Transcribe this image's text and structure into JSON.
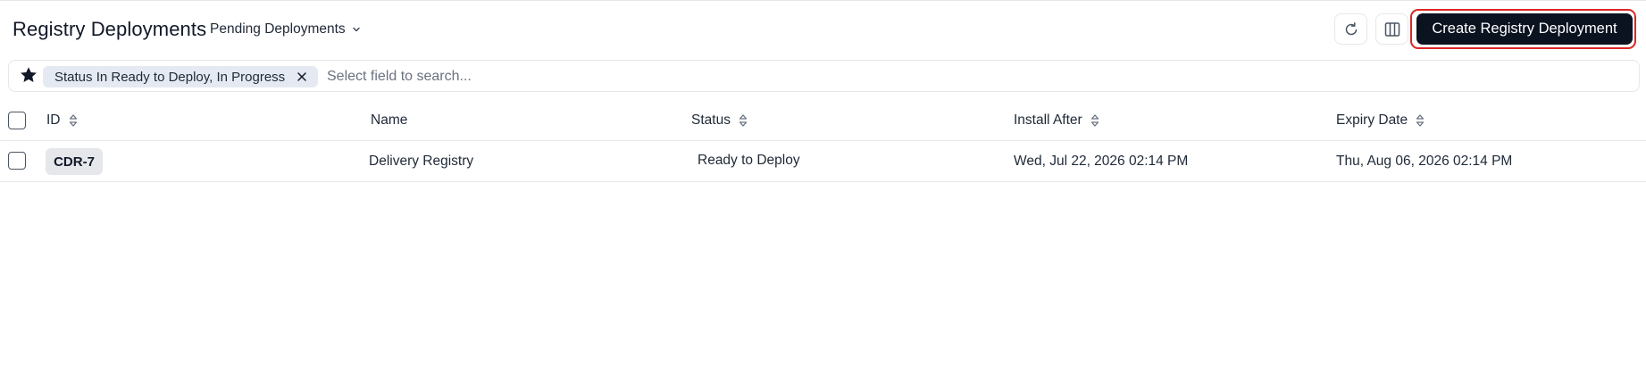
{
  "header": {
    "title": "Registry Deployments",
    "view_label": "Pending Deployments",
    "create_button_label": "Create Registry Deployment"
  },
  "filter": {
    "chip_label": "Status In Ready to Deploy, In Progress",
    "search_placeholder": "Select field to search..."
  },
  "table": {
    "columns": [
      "ID",
      "Name",
      "Status",
      "Install After",
      "Expiry Date"
    ],
    "rows": [
      {
        "id": "CDR-7",
        "name": "Delivery Registry",
        "status": "Ready to Deploy",
        "install_after": "Wed, Jul 22, 2026 02:14 PM",
        "expiry_date": "Thu, Aug 06, 2026 02:14 PM"
      }
    ]
  },
  "colors": {
    "accent": "#0b1220",
    "highlight": "#dc2626",
    "chip_bg": "#e5eaf2"
  }
}
